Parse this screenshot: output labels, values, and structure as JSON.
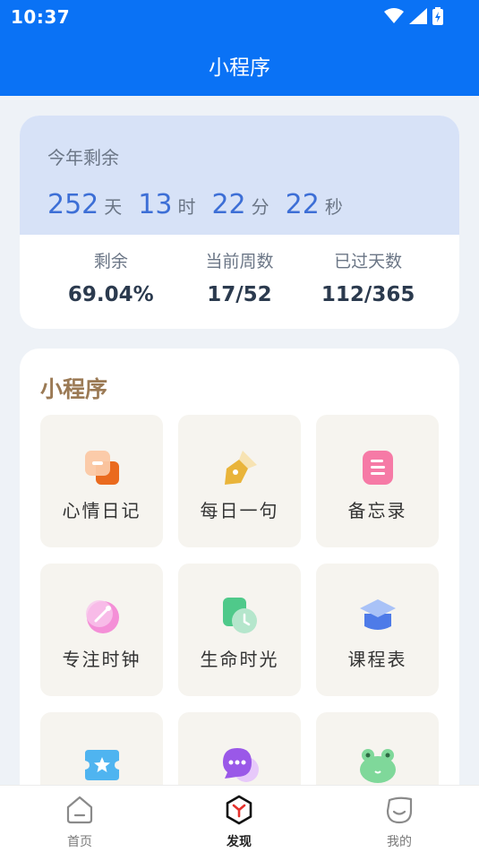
{
  "status_bar": {
    "time": "10:37"
  },
  "header": {
    "title": "小程序"
  },
  "countdown": {
    "label": "今年剩余",
    "days": "252",
    "days_unit": "天",
    "hours": "13",
    "hours_unit": "时",
    "minutes": "22",
    "minutes_unit": "分",
    "seconds": "22",
    "seconds_unit": "秒"
  },
  "stats": [
    {
      "label": "剩余",
      "value": "69.04%"
    },
    {
      "label": "当前周数",
      "value": "17/52"
    },
    {
      "label": "已过天数",
      "value": "112/365"
    }
  ],
  "apps": {
    "title": "小程序",
    "items": [
      {
        "label": "心情日记",
        "icon": "mood-diary-icon"
      },
      {
        "label": "每日一句",
        "icon": "pen-icon"
      },
      {
        "label": "备忘录",
        "icon": "memo-icon"
      },
      {
        "label": "专注时钟",
        "icon": "focus-clock-icon"
      },
      {
        "label": "生命时光",
        "icon": "life-time-icon"
      },
      {
        "label": "课程表",
        "icon": "graduation-cap-icon"
      },
      {
        "label": "",
        "icon": "ticket-icon"
      },
      {
        "label": "",
        "icon": "chat-bubble-icon"
      },
      {
        "label": "",
        "icon": "frog-icon"
      }
    ]
  },
  "tabbar": {
    "items": [
      {
        "label": "首页",
        "icon": "home-icon",
        "active": false
      },
      {
        "label": "发现",
        "icon": "discover-icon",
        "active": true
      },
      {
        "label": "我的",
        "icon": "profile-icon",
        "active": false
      }
    ]
  },
  "colors": {
    "header": "#0a72f5",
    "countdown_bg": "#d7e2f7",
    "countdown_number": "#3d6fd6",
    "apps_title": "#9b7a55",
    "tile_bg": "#f6f4ef"
  }
}
